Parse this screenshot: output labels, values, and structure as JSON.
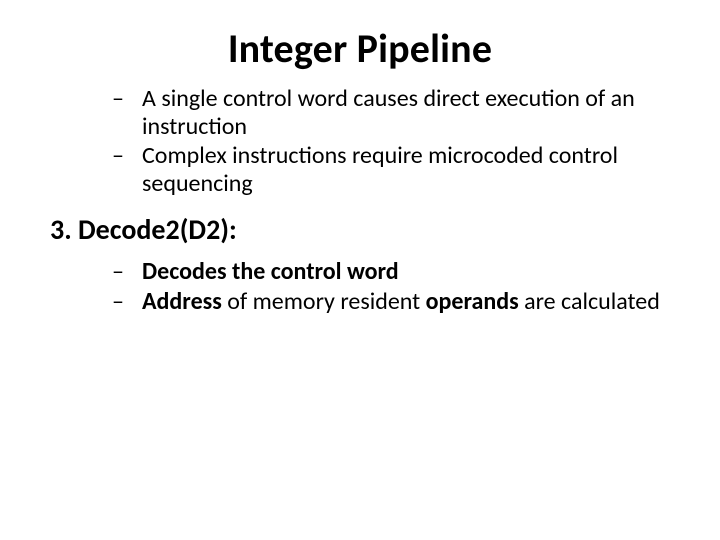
{
  "title": "Integer Pipeline",
  "topBullets": {
    "b1": "A single control word causes direct execution of an instruction",
    "b2": "Complex instructions require microcoded control sequencing"
  },
  "section": {
    "heading": "3. Decode2(D2):"
  },
  "bottomBullets": {
    "b1": "Decodes the control word",
    "b2_lead": "Address",
    "b2_mid": " of memory resident ",
    "b2_bold2": "operands",
    "b2_tail": " are calculated"
  }
}
